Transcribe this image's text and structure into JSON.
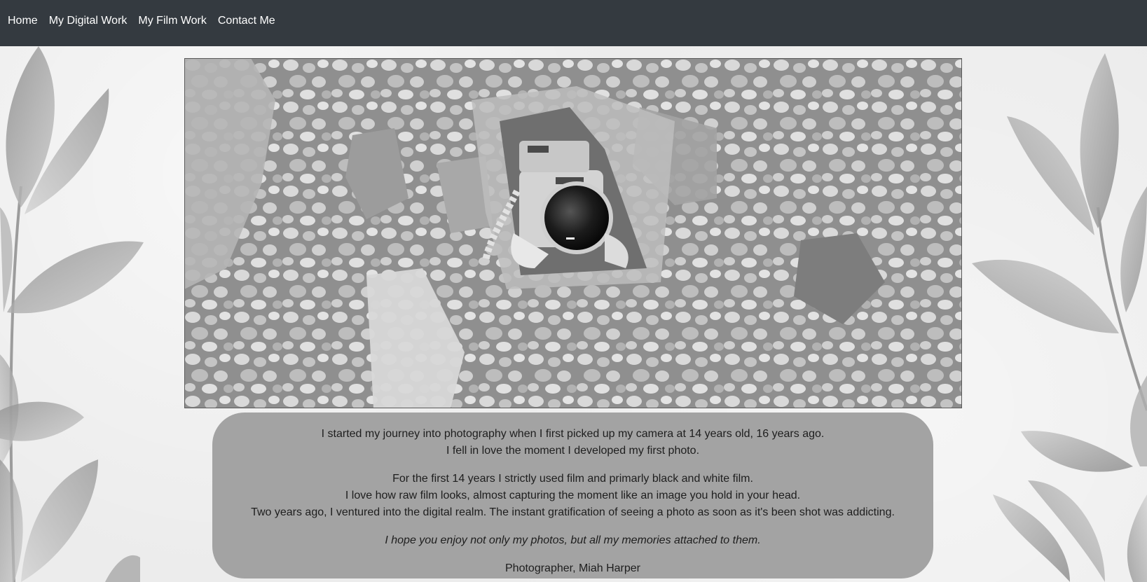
{
  "nav": {
    "items": [
      {
        "label": "Home"
      },
      {
        "label": "My Digital Work"
      },
      {
        "label": "My Film Work"
      },
      {
        "label": "Contact Me"
      }
    ]
  },
  "about": {
    "paragraph1": [
      "I started my journey into photography when I first picked up my camera at 14 years old, 16 years ago.",
      "I fell in love the moment I developed my first photo."
    ],
    "paragraph2": [
      "For the first 14 years I strictly used film and primarly black and white film.",
      "I love how raw film looks, almost capturing the moment like an image you hold in your head.",
      "Two years ago, I ventured into the digital realm. The instant gratification of seeing a photo as soon as it's been shot was addicting."
    ],
    "quote": "I hope you enjoy not only my photos, but all my memories attached to them.",
    "signature": "Photographer, Miah Harper"
  },
  "colors": {
    "navbar": "#343a40",
    "caption_bg": "#a3a3a3",
    "page_bg": "#ececec"
  }
}
